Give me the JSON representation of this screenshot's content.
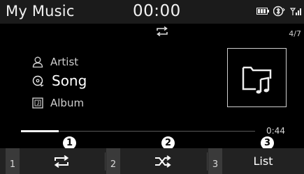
{
  "header": {
    "title": "My Music",
    "clock": "00:00",
    "status_icons": [
      "battery-icon",
      "bluetooth-phone-icon",
      "signal-icon"
    ]
  },
  "player": {
    "mode_indicator_icon": "repeat-icon",
    "track_counter": "4/7",
    "artist_label": "Artist",
    "song_label": "Song",
    "album_label": "Album",
    "album_art_icon": "music-folder-icon",
    "progress_fraction": 0.16,
    "time": "0:44"
  },
  "callouts": [
    "1",
    "2",
    "3"
  ],
  "bottom_buttons": [
    {
      "number": "1",
      "icon": "repeat-icon"
    },
    {
      "number": "2",
      "icon": "shuffle-icon"
    },
    {
      "number": "3",
      "label": "List"
    }
  ]
}
